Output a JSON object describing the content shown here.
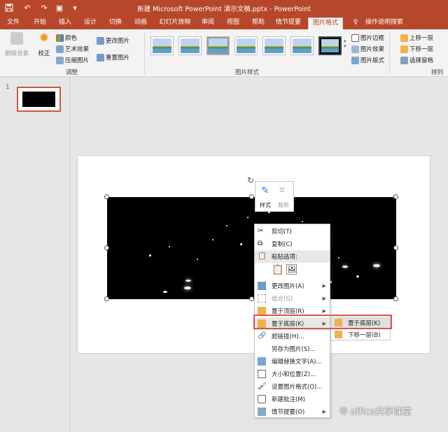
{
  "window": {
    "title": "新建 Microsoft PowerPoint 演示文稿.pptx - PowerPoint",
    "accent": "#b7472a"
  },
  "quick_access": [
    "save-icon",
    "undo-icon",
    "redo-icon",
    "present-icon",
    "customize-icon"
  ],
  "tabs": [
    "文件",
    "开始",
    "插入",
    "设计",
    "切换",
    "动画",
    "幻灯片放映",
    "审阅",
    "视图",
    "帮助",
    "情节提要",
    "图片格式"
  ],
  "active_tab": "图片格式",
  "tell_me": "操作说明搜索",
  "ribbon": {
    "remove_bg": "删除背景",
    "corrections": "校正",
    "color": "颜色",
    "artistic": "艺术效果",
    "compress": "压缩图片",
    "change_pic": "更改图片",
    "reset_pic": "重置图片",
    "adjust_group": "调整",
    "styles_group": "图片样式",
    "border": "图片边框",
    "effects": "图片效果",
    "layout": "图片版式",
    "bring_forward": "上移一层",
    "send_backward": "下移一层",
    "selection_pane": "选择窗格",
    "arrange_group": "排列"
  },
  "slide_number": "1",
  "mini_toolbar": {
    "style": "样式",
    "crop": "裁剪"
  },
  "context_menu": {
    "cut": "剪切(T)",
    "copy": "复制(C)",
    "paste_options": "粘贴选项:",
    "change_picture": "更改图片(A)",
    "group": "组合(G)",
    "bring_to_front": "置于顶层(R)",
    "send_to_back": "置于底层(K)",
    "hyperlink": "超链接(H)...",
    "save_as_picture": "另存为图片(S)...",
    "edit_alt_text": "编辑替换文字(A)...",
    "size_position": "大小和位置(Z)...",
    "format_picture": "设置图片格式(O)...",
    "new_comment": "新建批注(M)",
    "storyboard": "情节提要(O)"
  },
  "submenu": {
    "send_to_back": "置于底层(K)",
    "send_backward": "下移一层(B)"
  },
  "watermark": "office共享课堂"
}
